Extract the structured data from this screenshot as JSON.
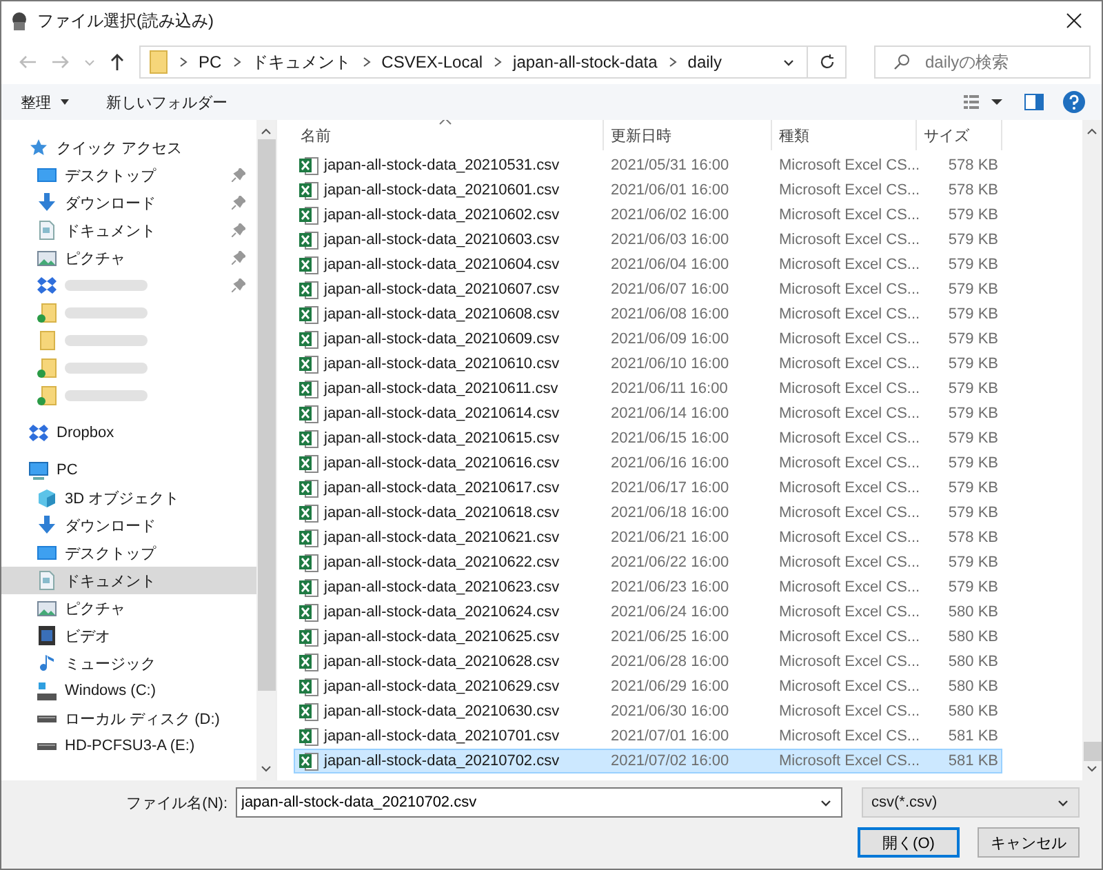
{
  "window": {
    "title": "ファイル選択(読み込み)"
  },
  "address": {
    "crumbs": [
      "PC",
      "ドキュメント",
      "CSVEX-Local",
      "japan-all-stock-data",
      "daily"
    ]
  },
  "search": {
    "placeholder": "dailyの検索"
  },
  "toolbar": {
    "organize": "整理",
    "new_folder": "新しいフォルダー"
  },
  "sidebar": {
    "items": [
      {
        "label": "クイック アクセス",
        "kind": "root",
        "selected": false,
        "children": [
          {
            "label": "デスクトップ",
            "kind": "item",
            "pinned": true,
            "selected": false
          },
          {
            "label": "ダウンロード",
            "kind": "item",
            "pinned": true,
            "selected": false
          },
          {
            "label": "ドキュメント",
            "kind": "item",
            "pinned": true,
            "selected": false
          },
          {
            "label": "ピクチャ",
            "kind": "item",
            "pinned": true,
            "selected": false
          },
          {
            "kind": "redacted",
            "pinned": true,
            "selected": false
          },
          {
            "kind": "redacted",
            "pinned": false,
            "selected": false
          },
          {
            "kind": "redacted",
            "pinned": false,
            "selected": false
          },
          {
            "kind": "redacted",
            "pinned": false,
            "selected": false
          },
          {
            "kind": "redacted",
            "pinned": false,
            "selected": false
          }
        ]
      },
      {
        "label": "Dropbox",
        "kind": "root",
        "selected": false
      },
      {
        "label": "PC",
        "kind": "root",
        "selected": false,
        "children": [
          {
            "label": "3D オブジェクト",
            "kind": "item",
            "selected": false
          },
          {
            "label": "ダウンロード",
            "kind": "item",
            "selected": false
          },
          {
            "label": "デスクトップ",
            "kind": "item",
            "selected": false
          },
          {
            "label": "ドキュメント",
            "kind": "item",
            "selected": true
          },
          {
            "label": "ピクチャ",
            "kind": "item",
            "selected": false
          },
          {
            "label": "ビデオ",
            "kind": "item",
            "selected": false
          },
          {
            "label": "ミュージック",
            "kind": "item",
            "selected": false
          },
          {
            "label": "Windows (C:)",
            "kind": "item",
            "selected": false
          },
          {
            "label": "ローカル ディスク (D:)",
            "kind": "item",
            "selected": false
          },
          {
            "label": "HD-PCFSU3-A (E:)",
            "kind": "item",
            "selected": false
          }
        ]
      }
    ]
  },
  "table": {
    "columns": [
      "名前",
      "更新日時",
      "種類",
      "サイズ"
    ],
    "rows": [
      {
        "name": "japan-all-stock-data_20210531.csv",
        "date": "2021/05/31 16:00",
        "type": "Microsoft Excel CS...",
        "size": "578 KB",
        "selected": false
      },
      {
        "name": "japan-all-stock-data_20210601.csv",
        "date": "2021/06/01 16:00",
        "type": "Microsoft Excel CS...",
        "size": "578 KB",
        "selected": false
      },
      {
        "name": "japan-all-stock-data_20210602.csv",
        "date": "2021/06/02 16:00",
        "type": "Microsoft Excel CS...",
        "size": "579 KB",
        "selected": false
      },
      {
        "name": "japan-all-stock-data_20210603.csv",
        "date": "2021/06/03 16:00",
        "type": "Microsoft Excel CS...",
        "size": "579 KB",
        "selected": false
      },
      {
        "name": "japan-all-stock-data_20210604.csv",
        "date": "2021/06/04 16:00",
        "type": "Microsoft Excel CS...",
        "size": "579 KB",
        "selected": false
      },
      {
        "name": "japan-all-stock-data_20210607.csv",
        "date": "2021/06/07 16:00",
        "type": "Microsoft Excel CS...",
        "size": "579 KB",
        "selected": false
      },
      {
        "name": "japan-all-stock-data_20210608.csv",
        "date": "2021/06/08 16:00",
        "type": "Microsoft Excel CS...",
        "size": "579 KB",
        "selected": false
      },
      {
        "name": "japan-all-stock-data_20210609.csv",
        "date": "2021/06/09 16:00",
        "type": "Microsoft Excel CS...",
        "size": "579 KB",
        "selected": false
      },
      {
        "name": "japan-all-stock-data_20210610.csv",
        "date": "2021/06/10 16:00",
        "type": "Microsoft Excel CS...",
        "size": "579 KB",
        "selected": false
      },
      {
        "name": "japan-all-stock-data_20210611.csv",
        "date": "2021/06/11 16:00",
        "type": "Microsoft Excel CS...",
        "size": "579 KB",
        "selected": false
      },
      {
        "name": "japan-all-stock-data_20210614.csv",
        "date": "2021/06/14 16:00",
        "type": "Microsoft Excel CS...",
        "size": "579 KB",
        "selected": false
      },
      {
        "name": "japan-all-stock-data_20210615.csv",
        "date": "2021/06/15 16:00",
        "type": "Microsoft Excel CS...",
        "size": "579 KB",
        "selected": false
      },
      {
        "name": "japan-all-stock-data_20210616.csv",
        "date": "2021/06/16 16:00",
        "type": "Microsoft Excel CS...",
        "size": "579 KB",
        "selected": false
      },
      {
        "name": "japan-all-stock-data_20210617.csv",
        "date": "2021/06/17 16:00",
        "type": "Microsoft Excel CS...",
        "size": "579 KB",
        "selected": false
      },
      {
        "name": "japan-all-stock-data_20210618.csv",
        "date": "2021/06/18 16:00",
        "type": "Microsoft Excel CS...",
        "size": "579 KB",
        "selected": false
      },
      {
        "name": "japan-all-stock-data_20210621.csv",
        "date": "2021/06/21 16:00",
        "type": "Microsoft Excel CS...",
        "size": "578 KB",
        "selected": false
      },
      {
        "name": "japan-all-stock-data_20210622.csv",
        "date": "2021/06/22 16:00",
        "type": "Microsoft Excel CS...",
        "size": "579 KB",
        "selected": false
      },
      {
        "name": "japan-all-stock-data_20210623.csv",
        "date": "2021/06/23 16:00",
        "type": "Microsoft Excel CS...",
        "size": "579 KB",
        "selected": false
      },
      {
        "name": "japan-all-stock-data_20210624.csv",
        "date": "2021/06/24 16:00",
        "type": "Microsoft Excel CS...",
        "size": "580 KB",
        "selected": false
      },
      {
        "name": "japan-all-stock-data_20210625.csv",
        "date": "2021/06/25 16:00",
        "type": "Microsoft Excel CS...",
        "size": "580 KB",
        "selected": false
      },
      {
        "name": "japan-all-stock-data_20210628.csv",
        "date": "2021/06/28 16:00",
        "type": "Microsoft Excel CS...",
        "size": "580 KB",
        "selected": false
      },
      {
        "name": "japan-all-stock-data_20210629.csv",
        "date": "2021/06/29 16:00",
        "type": "Microsoft Excel CS...",
        "size": "580 KB",
        "selected": false
      },
      {
        "name": "japan-all-stock-data_20210630.csv",
        "date": "2021/06/30 16:00",
        "type": "Microsoft Excel CS...",
        "size": "580 KB",
        "selected": false
      },
      {
        "name": "japan-all-stock-data_20210701.csv",
        "date": "2021/07/01 16:00",
        "type": "Microsoft Excel CS...",
        "size": "581 KB",
        "selected": false
      },
      {
        "name": "japan-all-stock-data_20210702.csv",
        "date": "2021/07/02 16:00",
        "type": "Microsoft Excel CS...",
        "size": "581 KB",
        "selected": true
      }
    ]
  },
  "footer": {
    "filename_label": "ファイル名(N):",
    "filename": "japan-all-stock-data_20210702.csv",
    "filter": "csv(*.csv)",
    "open": "開く(O)",
    "cancel": "キャンセル"
  }
}
